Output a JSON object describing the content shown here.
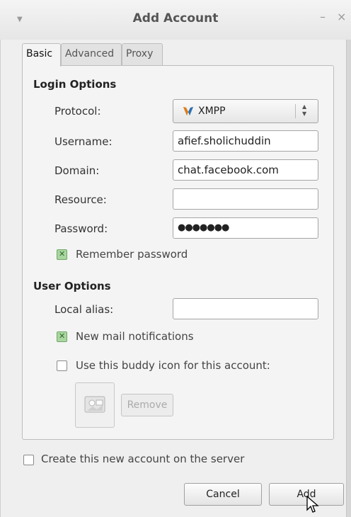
{
  "window": {
    "title": "Add Account",
    "menu_icon": "chevron-down-icon",
    "min_glyph": "–",
    "close_glyph": "×"
  },
  "tabs": [
    {
      "label": "Basic",
      "active": true
    },
    {
      "label": "Advanced",
      "active": false
    },
    {
      "label": "Proxy",
      "active": false
    }
  ],
  "login_options": {
    "heading": "Login Options",
    "protocol": {
      "label": "Protocol:",
      "value": "XMPP",
      "icon": "xmpp-icon"
    },
    "username": {
      "label": "Username:",
      "value": "afief.sholichuddin"
    },
    "domain": {
      "label": "Domain:",
      "value": "chat.facebook.com"
    },
    "resource": {
      "label": "Resource:",
      "value": ""
    },
    "password": {
      "label": "Password:",
      "value": "●●●●●●●"
    },
    "remember_password": {
      "label": "Remember password",
      "checked": true
    }
  },
  "user_options": {
    "heading": "User Options",
    "local_alias": {
      "label": "Local alias:",
      "value": ""
    },
    "new_mail": {
      "label": "New mail notifications",
      "checked": true
    },
    "buddy_icon": {
      "label": "Use this buddy icon for this account:",
      "checked": false
    },
    "remove_label": "Remove"
  },
  "create_account": {
    "label": "Create this new account on the server",
    "checked": false
  },
  "buttons": {
    "cancel": "Cancel",
    "add": "Add"
  },
  "colors": {
    "checkbox_checked": "#a9d6a0",
    "window_bg": "#efefef"
  }
}
